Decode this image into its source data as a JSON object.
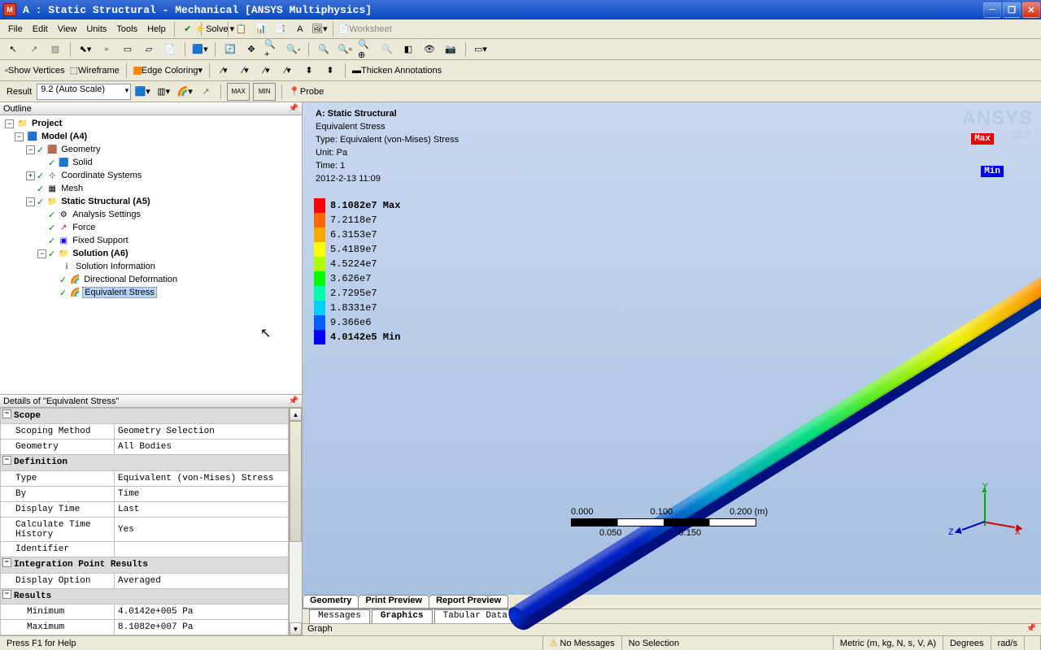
{
  "window": {
    "app_icon_letter": "M",
    "title": "A : Static Structural - Mechanical [ANSYS Multiphysics]"
  },
  "menubar": [
    "File",
    "Edit",
    "View",
    "Units",
    "Tools",
    "Help"
  ],
  "toolbar1": {
    "solve": "Solve",
    "worksheet": "Worksheet"
  },
  "toolbar2": {
    "show_vertices": "Show Vertices",
    "wireframe": "Wireframe",
    "edge_coloring": "Edge Coloring",
    "thicken": "Thicken Annotations"
  },
  "toolbar3": {
    "result_label": "Result",
    "scale": "9.2 (Auto Scale)",
    "probe": "Probe",
    "max_btn": "MAX",
    "min_btn": "MIN"
  },
  "outline": {
    "title": "Outline",
    "project": "Project",
    "model": "Model (A4)",
    "geometry": "Geometry",
    "solid": "Solid",
    "coord": "Coordinate Systems",
    "mesh": "Mesh",
    "static_struct": "Static Structural (A5)",
    "analysis_settings": "Analysis Settings",
    "force": "Force",
    "fixed_support": "Fixed Support",
    "solution": "Solution (A6)",
    "sol_info": "Solution Information",
    "dir_deform": "Directional Deformation",
    "equiv_stress": "Equivalent Stress"
  },
  "details": {
    "title": "Details of \"Equivalent Stress\"",
    "sections": {
      "scope": "Scope",
      "definition": "Definition",
      "integration": "Integration Point Results",
      "results": "Results"
    },
    "rows": {
      "scoping_method": {
        "l": "Scoping Method",
        "v": "Geometry Selection"
      },
      "geometry": {
        "l": "Geometry",
        "v": "All Bodies"
      },
      "type": {
        "l": "Type",
        "v": "Equivalent (von-Mises) Stress"
      },
      "by": {
        "l": "By",
        "v": "Time"
      },
      "display_time": {
        "l": "Display Time",
        "v": "Last"
      },
      "calc_history": {
        "l": "Calculate Time History",
        "v": "Yes"
      },
      "identifier": {
        "l": "Identifier",
        "v": ""
      },
      "display_option": {
        "l": "Display Option",
        "v": "Averaged"
      },
      "minimum": {
        "l": "Minimum",
        "v": "4.0142e+005 Pa"
      },
      "maximum": {
        "l": "Maximum",
        "v": "8.1082e+007 Pa"
      }
    }
  },
  "viewport": {
    "header": {
      "title": "A: Static Structural",
      "result": "Equivalent Stress",
      "type": "Type: Equivalent (von-Mises) Stress",
      "unit": "Unit: Pa",
      "time": "Time: 1",
      "timestamp": "2012-2-13 11:09"
    },
    "legend": [
      {
        "c": "#ff0000",
        "t": "8.1082e7 Max"
      },
      {
        "c": "#ff6600",
        "t": "7.2118e7"
      },
      {
        "c": "#ffaa00",
        "t": "6.3153e7"
      },
      {
        "c": "#ffff00",
        "t": "5.4189e7"
      },
      {
        "c": "#aaff00",
        "t": "4.5224e7"
      },
      {
        "c": "#00ff00",
        "t": "3.626e7"
      },
      {
        "c": "#00ffaa",
        "t": "2.7295e7"
      },
      {
        "c": "#00cfff",
        "t": "1.8331e7"
      },
      {
        "c": "#0060ff",
        "t": "9.366e6"
      },
      {
        "c": "#0000ff",
        "t": "4.0142e5 Min"
      }
    ],
    "max_tag": "Max",
    "min_tag": "Min",
    "scalebar": {
      "t0": "0.000",
      "t1": "0.100",
      "t2": "0.200 (m)",
      "m0": "0.050",
      "m1": "0.150"
    },
    "triad": {
      "x": "X",
      "y": "Y",
      "z": "Z"
    },
    "ansys": "ANSYS",
    "version": "13.0"
  },
  "tabs": {
    "view": [
      "Geometry",
      "Print Preview",
      "Report Preview"
    ],
    "sub": [
      "Messages",
      "Graphics",
      "Tabular Data"
    ],
    "graph": "Graph"
  },
  "statusbar": {
    "help": "Press F1 for Help",
    "no_messages": "No Messages",
    "no_selection": "No Selection",
    "units": "Metric (m, kg, N, s, V, A)",
    "degrees": "Degrees",
    "rads": "rad/s"
  }
}
